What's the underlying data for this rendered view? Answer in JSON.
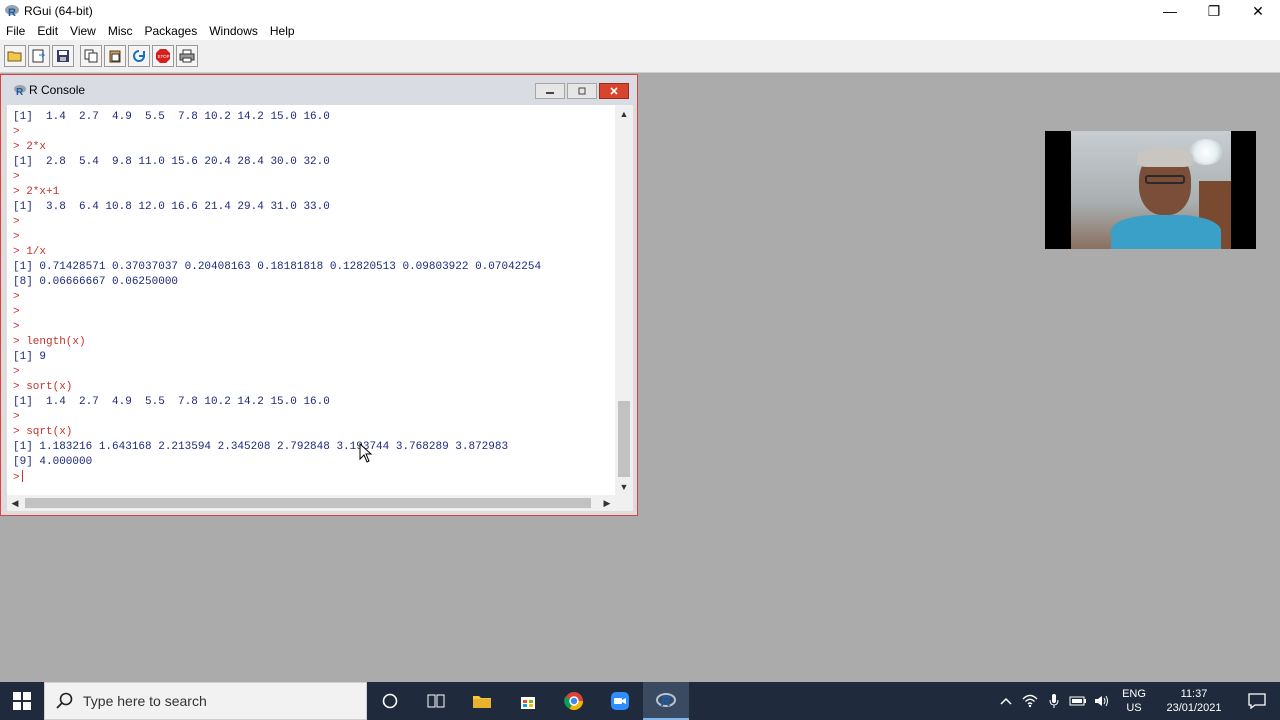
{
  "app": {
    "title": "RGui (64-bit)",
    "controls": {
      "minimize": "—",
      "restore": "❐",
      "close": "✕"
    }
  },
  "menu": [
    "File",
    "Edit",
    "View",
    "Misc",
    "Packages",
    "Windows",
    "Help"
  ],
  "toolbar": {
    "icons": [
      "open-script-icon",
      "load-workspace-icon",
      "save-workspace-icon",
      "copy-icon",
      "paste-icon",
      "copy-paste-icon",
      "stop-icon",
      "print-icon"
    ],
    "stop_color": "#d61f1f"
  },
  "console": {
    "title": "R Console",
    "lines": [
      {
        "type": "out",
        "text": "[1]  1.4  2.7  4.9  5.5  7.8 10.2 14.2 15.0 16.0"
      },
      {
        "type": "in",
        "text": ">"
      },
      {
        "type": "in",
        "text": "> 2*x"
      },
      {
        "type": "out",
        "text": "[1]  2.8  5.4  9.8 11.0 15.6 20.4 28.4 30.0 32.0"
      },
      {
        "type": "in",
        "text": ">"
      },
      {
        "type": "in",
        "text": "> 2*x+1"
      },
      {
        "type": "out",
        "text": "[1]  3.8  6.4 10.8 12.0 16.6 21.4 29.4 31.0 33.0"
      },
      {
        "type": "in",
        "text": ">"
      },
      {
        "type": "in",
        "text": ">"
      },
      {
        "type": "in",
        "text": "> 1/x"
      },
      {
        "type": "out",
        "text": "[1] 0.71428571 0.37037037 0.20408163 0.18181818 0.12820513 0.09803922 0.07042254"
      },
      {
        "type": "out",
        "text": "[8] 0.06666667 0.06250000"
      },
      {
        "type": "in",
        "text": ">"
      },
      {
        "type": "in",
        "text": ">"
      },
      {
        "type": "in",
        "text": ">"
      },
      {
        "type": "in",
        "text": "> length(x)"
      },
      {
        "type": "out",
        "text": "[1] 9"
      },
      {
        "type": "in",
        "text": ">"
      },
      {
        "type": "in",
        "text": "> sort(x)"
      },
      {
        "type": "out",
        "text": "[1]  1.4  2.7  4.9  5.5  7.8 10.2 14.2 15.0 16.0"
      },
      {
        "type": "in",
        "text": ">"
      },
      {
        "type": "in",
        "text": "> sqrt(x)"
      },
      {
        "type": "out",
        "text": "[1] 1.183216 1.643168 2.213594 2.345208 2.792848 3.193744 3.768289 3.872983"
      },
      {
        "type": "out",
        "text": "[9] 4.000000"
      }
    ],
    "prompt": ">",
    "input_color": "#c5322a",
    "output_color": "#1c2a7a"
  },
  "taskbar": {
    "search_placeholder": "Type here to search",
    "language": "ENG",
    "region": "US",
    "time": "11:37",
    "date": "23/01/2021"
  }
}
